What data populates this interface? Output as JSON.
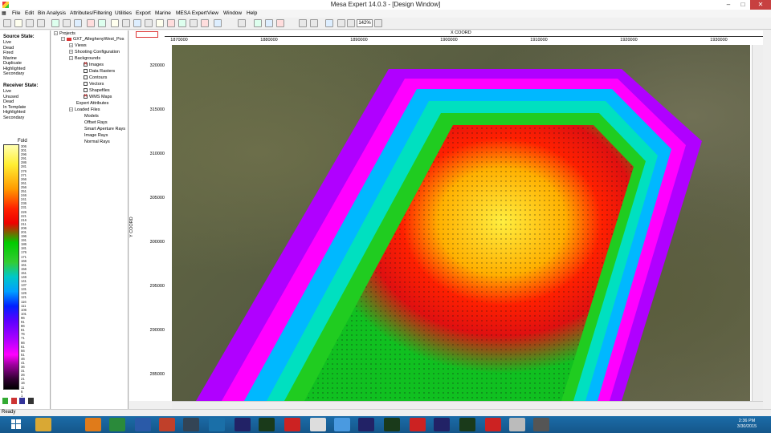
{
  "window": {
    "title": "Mesa Expert 14.0.3 - [Design Window]"
  },
  "menu": [
    "File",
    "Edit",
    "Bin Analysis",
    "Attributes/Filtering",
    "Utilities",
    "Export",
    "Marine",
    "MESA Expert",
    "View",
    "Window",
    "Help"
  ],
  "toolbar": {
    "zoom": "142%"
  },
  "source_state": {
    "title": "Source State:",
    "items": [
      "Live",
      "Dead",
      "Fired",
      "Marine",
      "Duplicate",
      "Highlighted",
      "Secondary"
    ]
  },
  "receiver_state": {
    "title": "Receiver State:",
    "items": [
      "Live",
      "Unused",
      "Dead",
      "In Template",
      "Highlighted",
      "Secondary"
    ]
  },
  "colorbar": {
    "title": "Fold",
    "ticks": [
      "306",
      "301",
      "296",
      "291",
      "286",
      "281",
      "276",
      "271",
      "266",
      "261",
      "256",
      "251",
      "246",
      "241",
      "236",
      "231",
      "226",
      "221",
      "216",
      "211",
      "206",
      "201",
      "196",
      "191",
      "186",
      "181",
      "176",
      "171",
      "166",
      "161",
      "156",
      "151",
      "146",
      "141",
      "137",
      "131",
      "126",
      "121",
      "116",
      "111",
      "106",
      "101",
      "96",
      "91",
      "86",
      "81",
      "76",
      "71",
      "66",
      "61",
      "56",
      "51",
      "46",
      "41",
      "36",
      "31",
      "26",
      "21",
      "16",
      "11",
      "6",
      "1"
    ]
  },
  "tree": {
    "root": "Projects",
    "project": "GXT_AlleghenyWest_Pos",
    "views": "Views",
    "shooting": "Shooting Configuration",
    "backgrounds": "Backgrounds",
    "bg_items": [
      {
        "label": "Images",
        "checked": true
      },
      {
        "label": "Data Rasters",
        "checked": false
      },
      {
        "label": "Contours",
        "checked": false
      },
      {
        "label": "Vectors",
        "checked": false
      },
      {
        "label": "Shapefiles",
        "checked": false
      },
      {
        "label": "WMS Maps",
        "checked": true
      }
    ],
    "expert": "Expert Attributes",
    "loaded": "Loaded Files",
    "loaded_items": [
      "Models",
      "Offset Rays",
      "Smart Aperture Rays",
      "Image Rays",
      "Normal Rays"
    ]
  },
  "plot": {
    "x_title": "X COORD",
    "y_title": "Y COORD",
    "x_ticks": [
      "1870000",
      "1880000",
      "1890000",
      "1900000",
      "1910000",
      "1920000",
      "1930000"
    ],
    "y_ticks": [
      "320000",
      "315000",
      "310000",
      "305000",
      "300000",
      "295000",
      "290000",
      "285000"
    ]
  },
  "status": "Ready",
  "clock": {
    "time": "2:36 PM",
    "date": "3/30/2015"
  }
}
